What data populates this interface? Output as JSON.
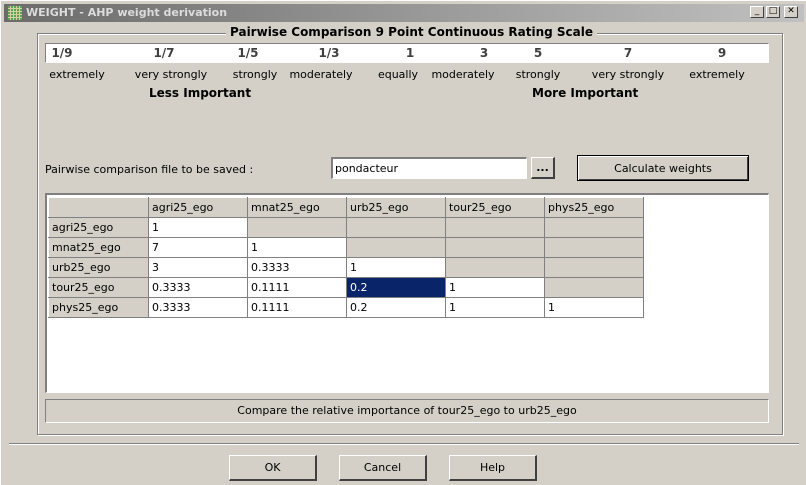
{
  "window": {
    "title": "WEIGHT - AHP weight derivation",
    "min_glyph": "_",
    "max_glyph": "□",
    "close_glyph": "✕"
  },
  "scale": {
    "group_title": "Pairwise Comparison 9 Point Continuous Rating Scale",
    "values": [
      "1/9",
      "1/7",
      "1/5",
      "1/3",
      "1",
      "3",
      "5",
      "7",
      "9"
    ],
    "words": [
      "extremely",
      "very strongly",
      "strongly",
      "moderately",
      "equally",
      "moderately",
      "strongly",
      "very strongly",
      "extremely"
    ],
    "less_label": "Less Important",
    "more_label": "More Important"
  },
  "file": {
    "label": "Pairwise comparison file to be saved :",
    "value": "pondacteur",
    "browse_label": "...",
    "calculate_label": "Calculate weights"
  },
  "matrix": {
    "columns": [
      "agri25_ego",
      "mnat25_ego",
      "urb25_ego",
      "tour25_ego",
      "phys25_ego"
    ],
    "rows": [
      {
        "name": "agri25_ego",
        "cells": [
          "1",
          "",
          "",
          "",
          ""
        ]
      },
      {
        "name": "mnat25_ego",
        "cells": [
          "7",
          "1",
          "",
          "",
          ""
        ]
      },
      {
        "name": "urb25_ego",
        "cells": [
          "3",
          "0.3333",
          "1",
          "",
          ""
        ]
      },
      {
        "name": "tour25_ego",
        "cells": [
          "0.3333",
          "0.1111",
          "0.2",
          "1",
          ""
        ]
      },
      {
        "name": "phys25_ego",
        "cells": [
          "0.3333",
          "0.1111",
          "0.2",
          "1",
          "1"
        ]
      }
    ],
    "selected_row": 3,
    "selected_col": 2
  },
  "status": "Compare the relative importance of tour25_ego to urb25_ego",
  "buttons": {
    "ok": "OK",
    "cancel": "Cancel",
    "help": "Help"
  },
  "colors": {
    "selection": "#0a246a",
    "face": "#d4d0c8"
  }
}
